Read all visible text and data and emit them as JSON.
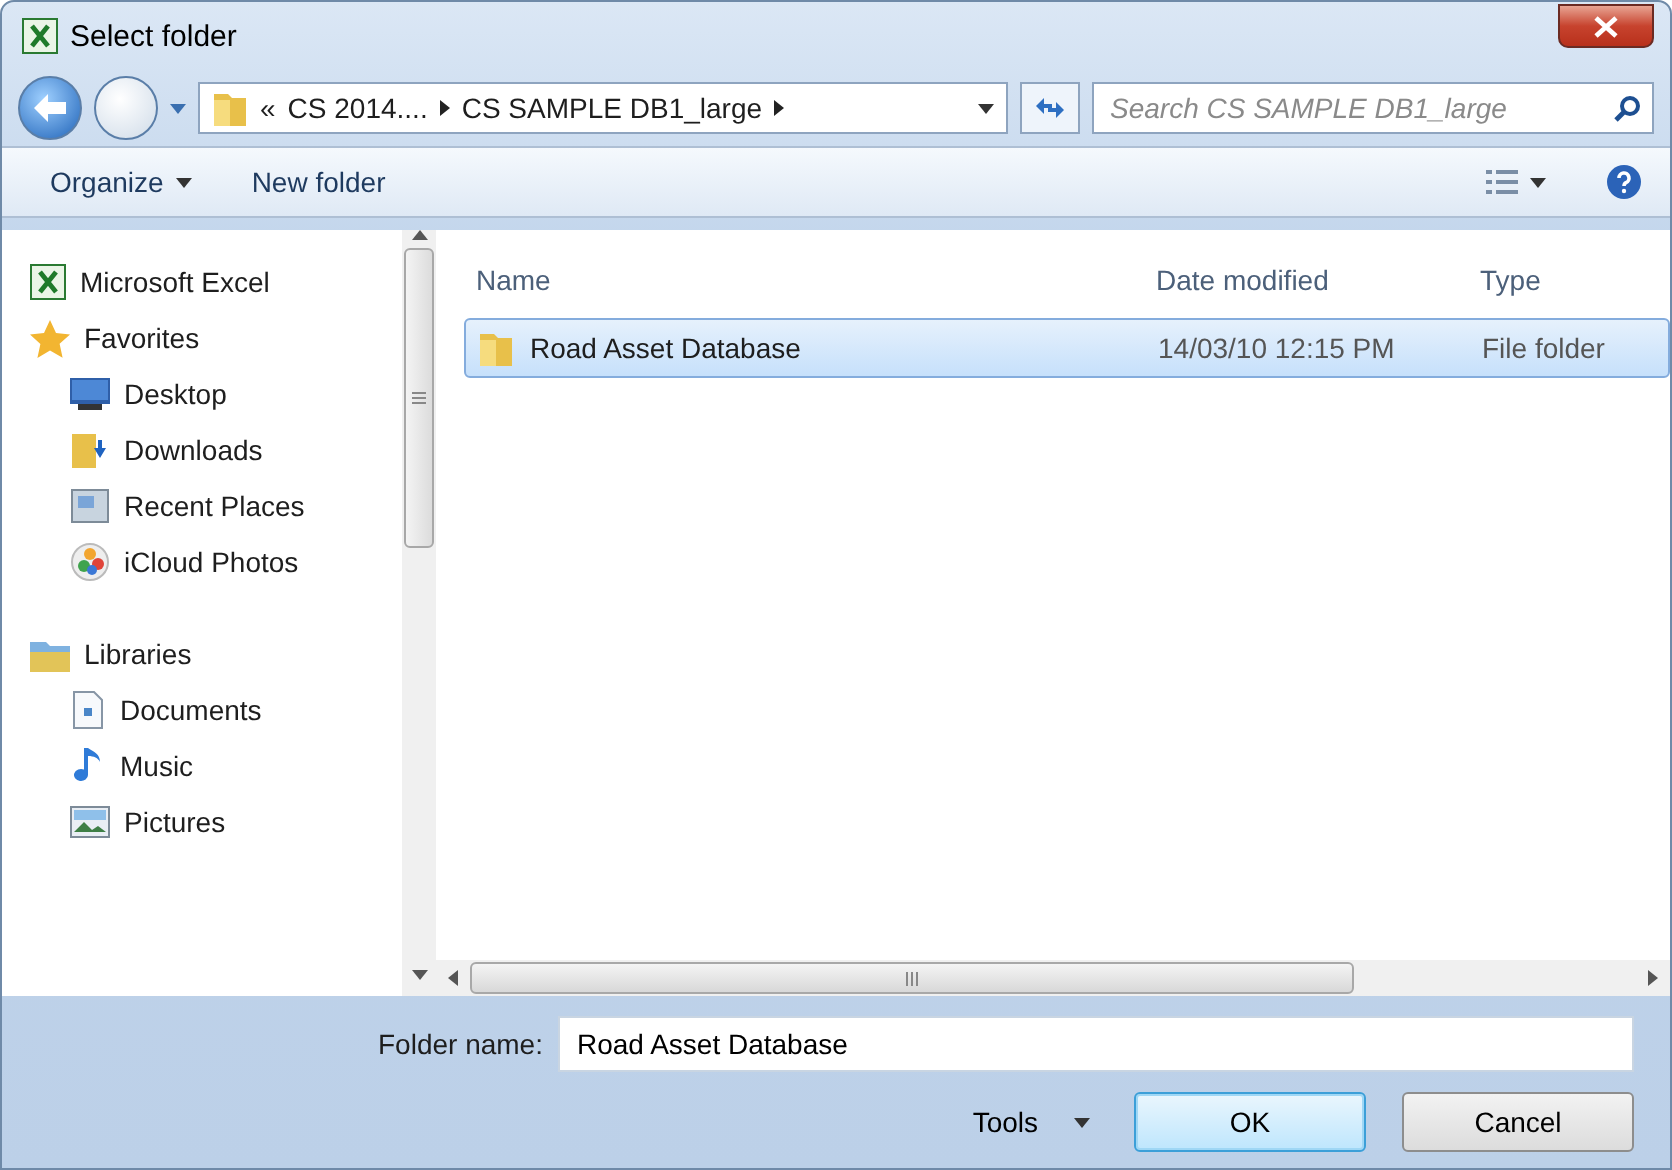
{
  "window": {
    "title": "Select folder"
  },
  "address": {
    "overflow_mark": "«",
    "crumbs": [
      "CS 2014....",
      "CS SAMPLE DB1_large"
    ]
  },
  "search": {
    "placeholder": "Search CS SAMPLE DB1_large"
  },
  "toolbar": {
    "organize": "Organize",
    "new_folder": "New folder"
  },
  "sidebar": {
    "groups": [
      {
        "label": "Microsoft Excel"
      },
      {
        "label": "Favorites",
        "children": [
          {
            "label": "Desktop"
          },
          {
            "label": "Downloads"
          },
          {
            "label": "Recent Places"
          },
          {
            "label": "iCloud Photos"
          }
        ]
      },
      {
        "label": "Libraries",
        "children": [
          {
            "label": "Documents"
          },
          {
            "label": "Music"
          },
          {
            "label": "Pictures"
          }
        ]
      }
    ]
  },
  "table": {
    "columns": [
      "Name",
      "Date modified",
      "Type"
    ],
    "rows": [
      {
        "name": "Road Asset Database",
        "date": "14/03/10 12:15 PM",
        "type": "File folder",
        "selected": true
      }
    ]
  },
  "folder_name": {
    "label": "Folder name:",
    "value": "Road Asset Database"
  },
  "buttons": {
    "tools": "Tools",
    "ok": "OK",
    "cancel": "Cancel"
  }
}
